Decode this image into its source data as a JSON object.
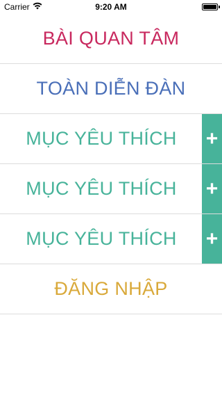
{
  "status_bar": {
    "carrier": "Carrier",
    "time": "9:20 AM",
    "battery_level": 1.0
  },
  "menu": {
    "items": [
      {
        "label": "BÀI QUAN TÂM",
        "color": "#c8285e",
        "has_add": false
      },
      {
        "label": "TOÀN DIỄN ĐÀN",
        "color": "#4a6fb8",
        "has_add": false
      },
      {
        "label": "MỤC YÊU THÍCH",
        "color": "#47b39a",
        "has_add": true,
        "add_label": "+"
      },
      {
        "label": "MỤC YÊU THÍCH",
        "color": "#47b39a",
        "has_add": true,
        "add_label": "+"
      },
      {
        "label": "MỤC YÊU THÍCH",
        "color": "#47b39a",
        "has_add": true,
        "add_label": "+"
      },
      {
        "label": "ĐĂNG NHẬP",
        "color": "#d9a93a",
        "has_add": false
      }
    ],
    "add_button_color": "#47b39a"
  },
  "icons": {
    "wifi": "wifi-icon",
    "battery": "battery-icon",
    "add": "plus-icon"
  }
}
